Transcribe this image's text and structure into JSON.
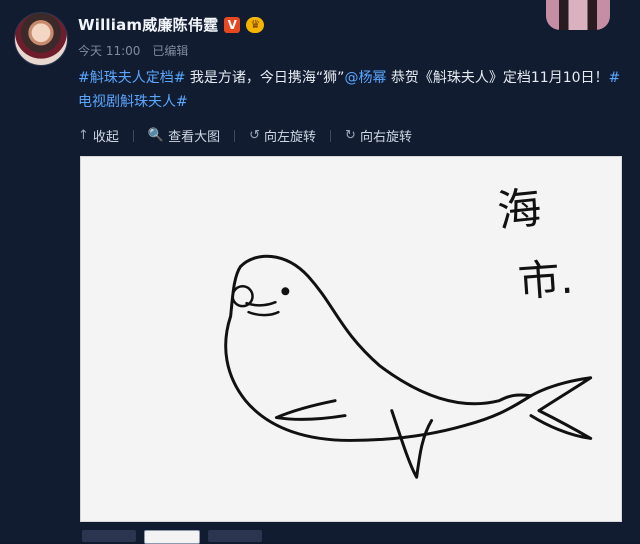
{
  "post": {
    "username": "William威廉陈伟霆",
    "badges": {
      "v": "V",
      "crown": "♛"
    },
    "time": "今天 11:00",
    "edited": "已编辑",
    "text": {
      "tag1": "#斛珠夫人定档#",
      "part1": " 我是方诸，今日携海“狮”",
      "mention": "@杨幂",
      "part2": " 恭贺《斛珠夫人》定档11月10日！",
      "tag2": "#电视剧斛珠夫人#"
    },
    "toolbar": {
      "collapse": "收起",
      "view_large": "查看大图",
      "rotate_left": "向左旋转",
      "rotate_right": "向右旋转"
    },
    "image": {
      "handwriting": [
        "海",
        "市."
      ]
    }
  },
  "icons": {
    "collapse": "↑",
    "view_large": "🔍",
    "rotate_left": "↺",
    "rotate_right": "↻"
  }
}
